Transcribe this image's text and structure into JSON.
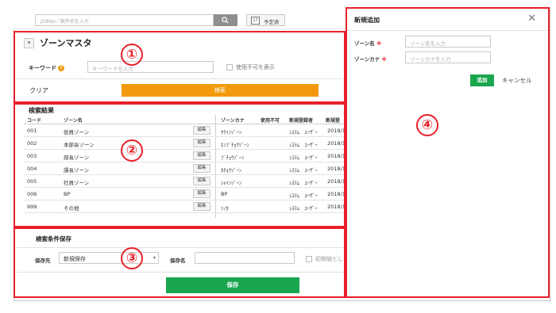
{
  "topbar": {
    "search_placeholder": "JOBNo／案件名を入力",
    "schedule_label": "予定表",
    "calendar_day": "17"
  },
  "section1": {
    "title": "ゾーンマスタ",
    "toggle_symbol": "▾",
    "keyword_label": "キーワード",
    "help_symbol": "?",
    "keyword_placeholder": "キーワードを入力",
    "include_disabled_label": "使用不可を表示",
    "clear_label": "クリア",
    "search_label": "検索"
  },
  "results": {
    "title": "検索結果",
    "columns": [
      "コード",
      "ゾーン名",
      "ゾーンカナ",
      "使用不可",
      "新規登録者",
      "新規登"
    ],
    "edit_label": "編集",
    "rows": [
      {
        "code": "001",
        "name": "役員ゾーン",
        "kana": "ﾔｸｲﾝｿﾞｰﾝ",
        "registrar": "ｼｽﾃﾑ　ﾕｰｻﾞｰ",
        "date": "2018/1"
      },
      {
        "code": "002",
        "name": "本部長ゾーン",
        "kana": "ﾎﾝﾌﾞﾁｮｳｿﾞｰﾝ",
        "registrar": "ｼｽﾃﾑ　ﾕｰｻﾞｰ",
        "date": "2018/1"
      },
      {
        "code": "003",
        "name": "部長ゾーン",
        "kana": "ﾌﾞﾁｮｳｿﾞｰﾝ",
        "registrar": "ｼｽﾃﾑ　ﾕｰｻﾞｰ",
        "date": "2018/1"
      },
      {
        "code": "004",
        "name": "課長ゾーン",
        "kana": "ｶﾁｮｳｿﾞｰﾝ",
        "registrar": "ｼｽﾃﾑ　ﾕｰｻﾞｰ",
        "date": "2018/1"
      },
      {
        "code": "005",
        "name": "社員ゾーン",
        "kana": "ｼｬｲﾝｿﾞｰﾝ",
        "registrar": "ｼｽﾃﾑ　ﾕｰｻﾞｰ",
        "date": "2018/1"
      },
      {
        "code": "006",
        "name": "BP",
        "kana": "BP",
        "registrar": "ｼｽﾃﾑ　ﾕｰｻﾞｰ",
        "date": "2018/1"
      },
      {
        "code": "999",
        "name": "その他",
        "kana": "ｿﾉﾀ",
        "registrar": "ｼｽﾃﾑ　ﾕｰｻﾞｰ",
        "date": "2018/1"
      }
    ]
  },
  "section3": {
    "title": "検索条件保存",
    "save_to_label": "保存先",
    "save_to_value": "新規保存",
    "save_name_label": "保存名",
    "default_label": "初期値とし",
    "save_label": "保存"
  },
  "panel": {
    "title": "新規追加",
    "close_symbol": "✕",
    "zone_name_label": "ゾーン名",
    "zone_name_placeholder": "ゾーン名を入力",
    "zone_kana_label": "ゾーンカナ",
    "zone_kana_placeholder": "ゾーンカナを入力",
    "required_mark": "※",
    "add_label": "追加",
    "cancel_label": "キャンセル"
  },
  "callouts": [
    "①",
    "②",
    "③",
    "④"
  ],
  "colors": {
    "callout": "#e8202a",
    "search_button": "#f29a0c",
    "save_button": "#1aa64f",
    "help_icon": "#f39c12"
  }
}
